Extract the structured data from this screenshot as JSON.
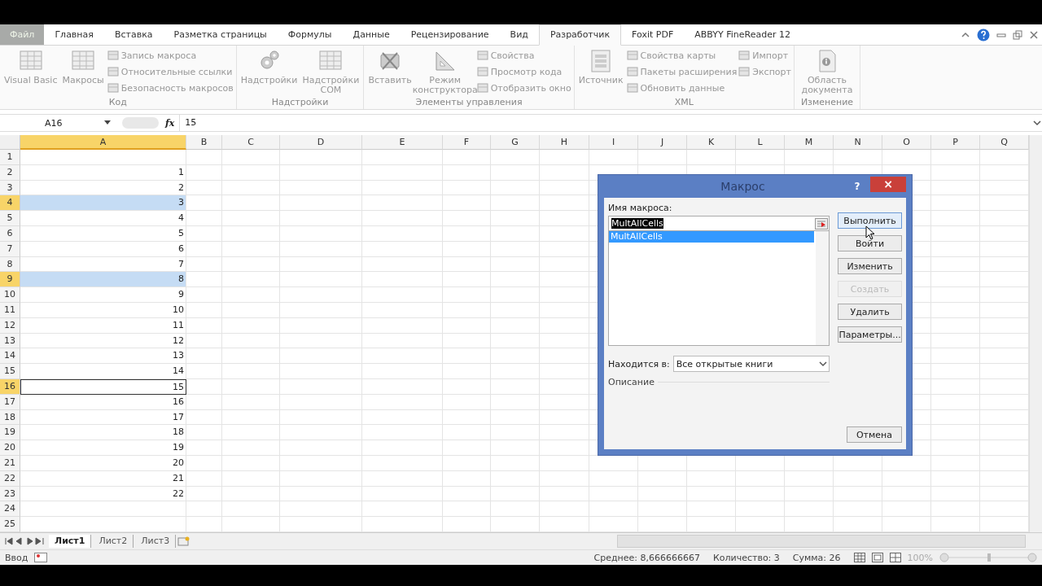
{
  "ribbon_tabs": [
    {
      "label": "Файл",
      "kind": "file",
      "selected": false
    },
    {
      "label": "Главная",
      "kind": "tab",
      "selected": false
    },
    {
      "label": "Вставка",
      "kind": "tab",
      "selected": false
    },
    {
      "label": "Разметка страницы",
      "kind": "tab",
      "selected": false
    },
    {
      "label": "Формулы",
      "kind": "tab",
      "selected": false
    },
    {
      "label": "Данные",
      "kind": "tab",
      "selected": false
    },
    {
      "label": "Рецензирование",
      "kind": "tab",
      "selected": false
    },
    {
      "label": "Вид",
      "kind": "tab",
      "selected": false
    },
    {
      "label": "Разработчик",
      "kind": "tab",
      "selected": true
    },
    {
      "label": "Foxit PDF",
      "kind": "tab",
      "selected": false
    },
    {
      "label": "ABBYY FineReader 12",
      "kind": "tab",
      "selected": false
    }
  ],
  "ribbon_groups": [
    {
      "title": "Код",
      "items": [
        {
          "kind": "large",
          "label": "Visual Basic"
        },
        {
          "kind": "large",
          "label": "Макросы"
        },
        {
          "kind": "small",
          "label": "Запись макроса"
        },
        {
          "kind": "small",
          "label": "Относительные ссылки"
        },
        {
          "kind": "small",
          "label": "Безопасность макросов"
        }
      ]
    },
    {
      "title": "Надстройки",
      "items": [
        {
          "kind": "large",
          "label": "Надстройки"
        },
        {
          "kind": "large",
          "label": "Надстройки COM"
        }
      ]
    },
    {
      "title": "Элементы управления",
      "items": [
        {
          "kind": "large",
          "label": "Вставить"
        },
        {
          "kind": "large",
          "label": "Режим конструктора"
        },
        {
          "kind": "small",
          "label": "Свойства"
        },
        {
          "kind": "small",
          "label": "Просмотр кода"
        },
        {
          "kind": "small",
          "label": "Отобразить окно"
        }
      ]
    },
    {
      "title": "XML",
      "items": [
        {
          "kind": "large",
          "label": "Источник"
        },
        {
          "kind": "small",
          "label": "Свойства карты"
        },
        {
          "kind": "small",
          "label": "Пакеты расширения"
        },
        {
          "kind": "small",
          "label": "Обновить данные"
        },
        {
          "kind": "small",
          "label": "Импорт"
        },
        {
          "kind": "small",
          "label": "Экспорт"
        }
      ]
    },
    {
      "title": "Изменение",
      "items": [
        {
          "kind": "large",
          "label": "Область документа"
        }
      ]
    }
  ],
  "formula_bar": {
    "name_box": "A16",
    "fx": "fx",
    "value": "15"
  },
  "sheet": {
    "columns": [
      {
        "label": "A",
        "selected": true
      },
      {
        "label": "B",
        "selected": false
      },
      {
        "label": "C",
        "selected": false
      },
      {
        "label": "D",
        "selected": false
      },
      {
        "label": "E",
        "selected": false
      },
      {
        "label": "F",
        "selected": false
      },
      {
        "label": "G",
        "selected": false
      },
      {
        "label": "H",
        "selected": false
      },
      {
        "label": "I",
        "selected": false
      },
      {
        "label": "J",
        "selected": false
      },
      {
        "label": "K",
        "selected": false
      },
      {
        "label": "L",
        "selected": false
      },
      {
        "label": "M",
        "selected": false
      },
      {
        "label": "N",
        "selected": false
      },
      {
        "label": "O",
        "selected": false
      },
      {
        "label": "P",
        "selected": false
      },
      {
        "label": "Q",
        "selected": false
      }
    ],
    "rows": [
      {
        "header": "1",
        "value": "",
        "selected": false,
        "active": false
      },
      {
        "header": "2",
        "value": "1",
        "selected": false,
        "active": false
      },
      {
        "header": "3",
        "value": "2",
        "selected": false,
        "active": false
      },
      {
        "header": "4",
        "value": "3",
        "selected": true,
        "active": false
      },
      {
        "header": "5",
        "value": "4",
        "selected": false,
        "active": false
      },
      {
        "header": "6",
        "value": "5",
        "selected": false,
        "active": false
      },
      {
        "header": "7",
        "value": "6",
        "selected": false,
        "active": false
      },
      {
        "header": "8",
        "value": "7",
        "selected": false,
        "active": false
      },
      {
        "header": "9",
        "value": "8",
        "selected": true,
        "active": false
      },
      {
        "header": "10",
        "value": "9",
        "selected": false,
        "active": false
      },
      {
        "header": "11",
        "value": "10",
        "selected": false,
        "active": false
      },
      {
        "header": "12",
        "value": "11",
        "selected": false,
        "active": false
      },
      {
        "header": "13",
        "value": "12",
        "selected": false,
        "active": false
      },
      {
        "header": "14",
        "value": "13",
        "selected": false,
        "active": false
      },
      {
        "header": "15",
        "value": "14",
        "selected": false,
        "active": false
      },
      {
        "header": "16",
        "value": "15",
        "selected": false,
        "active": true
      },
      {
        "header": "17",
        "value": "16",
        "selected": false,
        "active": false
      },
      {
        "header": "18",
        "value": "17",
        "selected": false,
        "active": false
      },
      {
        "header": "19",
        "value": "18",
        "selected": false,
        "active": false
      },
      {
        "header": "20",
        "value": "19",
        "selected": false,
        "active": false
      },
      {
        "header": "21",
        "value": "20",
        "selected": false,
        "active": false
      },
      {
        "header": "22",
        "value": "21",
        "selected": false,
        "active": false
      },
      {
        "header": "23",
        "value": "22",
        "selected": false,
        "active": false
      },
      {
        "header": "24",
        "value": "",
        "selected": false,
        "active": false
      },
      {
        "header": "25",
        "value": "",
        "selected": false,
        "active": false
      }
    ]
  },
  "sheet_tabs": [
    {
      "label": "Лист1",
      "selected": true
    },
    {
      "label": "Лист2",
      "selected": false
    },
    {
      "label": "Лист3",
      "selected": false
    }
  ],
  "status_bar": {
    "mode": "Ввод",
    "average": "Среднее: 8,666666667",
    "count": "Количество: 3",
    "sum": "Сумма: 26",
    "zoom": "100%",
    "zoom_slider": {
      "level": 0.5
    }
  },
  "dialog": {
    "title": "Макрос",
    "help": "?",
    "close": "×",
    "name_label": "Имя макроса:",
    "name_value": "MultAllCells",
    "macros": [
      {
        "label": "MultAllCells",
        "selected": true
      }
    ],
    "buttons": [
      {
        "label": "Выполнить",
        "disabled": false
      },
      {
        "label": "Войти",
        "disabled": false
      },
      {
        "label": "Изменить",
        "disabled": false
      },
      {
        "label": "Создать",
        "disabled": true
      },
      {
        "label": "Удалить",
        "disabled": false
      },
      {
        "label": "Параметры...",
        "disabled": false
      }
    ],
    "location_label": "Находится в:",
    "location_value": "Все открытые книги",
    "description_label": "Описание",
    "cancel": "Отмена"
  }
}
